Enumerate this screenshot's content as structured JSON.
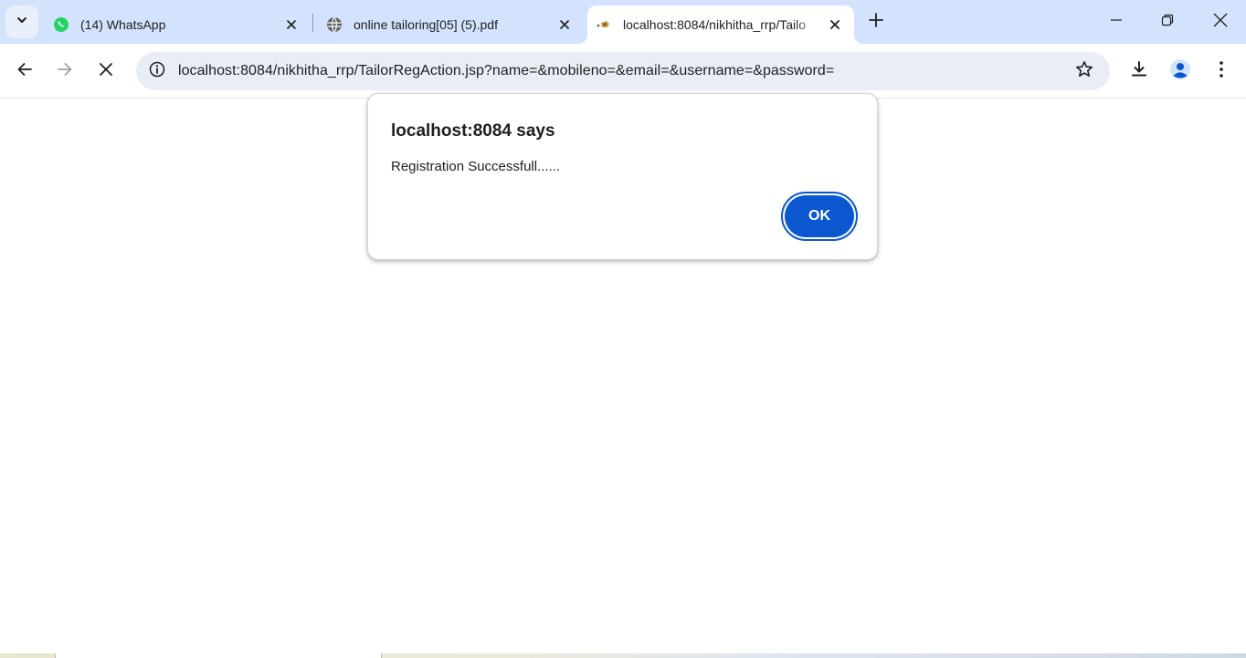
{
  "window": {
    "tabs": [
      {
        "title": "(14) WhatsApp",
        "favicon": "whatsapp-icon",
        "active": false
      },
      {
        "title": "online tailoring[05] (5).pdf",
        "favicon": "globe-icon",
        "active": false
      },
      {
        "title": "localhost:8084/nikhitha_rrp/Tailo",
        "favicon": "site-favicon-icon",
        "active": true
      }
    ]
  },
  "toolbar": {
    "url": "localhost:8084/nikhitha_rrp/TailorRegAction.jsp?name=&mobileno=&email=&username=&password="
  },
  "dialog": {
    "title": "localhost:8084 says",
    "message": "Registration Successfull......",
    "ok_label": "OK"
  },
  "colors": {
    "tabstrip_bg": "#d3e3fd",
    "omnibox_bg": "#e9eef6",
    "accent": "#0b57d0",
    "whatsapp": "#25d366"
  }
}
